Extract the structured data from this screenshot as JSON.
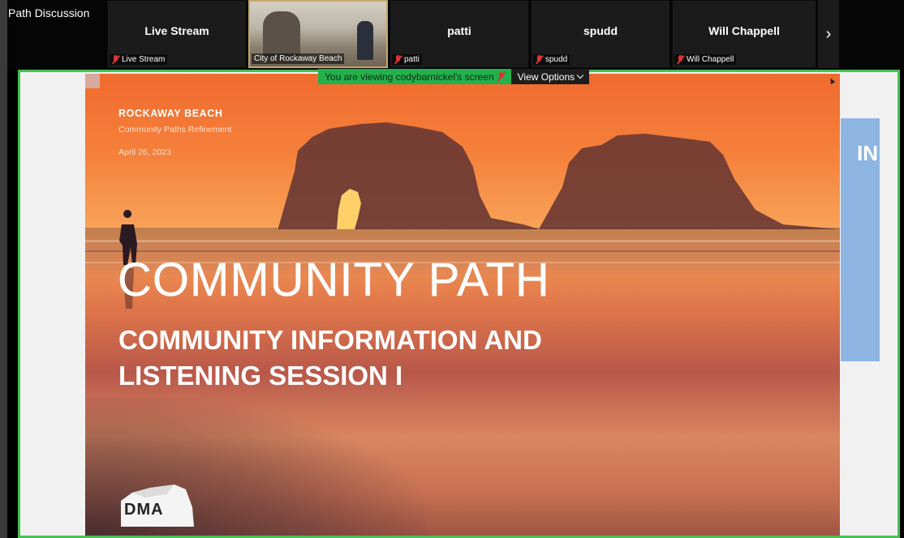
{
  "meeting": {
    "title": "Path Discussion"
  },
  "participants": [
    {
      "name": "Live Stream",
      "label": "Live Stream"
    },
    {
      "name": "",
      "label": "City of Rockaway Beach"
    },
    {
      "name": "patti",
      "label": "patti"
    },
    {
      "name": "spudd",
      "label": "spudd"
    },
    {
      "name": "Will Chappell",
      "label": "Will Chappell"
    }
  ],
  "share": {
    "banner_text": "You are viewing codybarnickel's screen",
    "view_options_label": "View Options"
  },
  "slide": {
    "location": "ROCKAWAY BEACH",
    "subtitle": "Community Paths Refinement",
    "date": "April 26, 2023",
    "headline_light": "COMMUNITY PATH",
    "headline_bold_line1": "COMMUNITY INFORMATION AND",
    "headline_bold_line2": "LISTENING SESSION I",
    "logo_text": "DMA"
  },
  "next_slide": {
    "text": "IN"
  },
  "colors": {
    "share_border": "#46c254",
    "banner_bg": "#22b14c",
    "mic_muted": "#e0332e"
  }
}
